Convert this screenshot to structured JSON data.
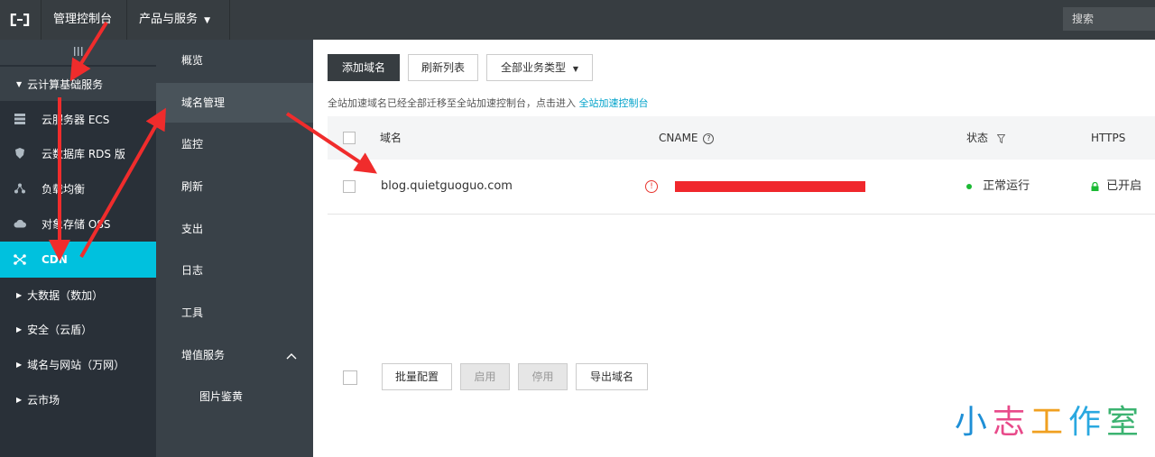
{
  "topbar": {
    "console_label": "管理控制台",
    "products_label": "产品与服务",
    "search_placeholder": "搜索"
  },
  "sidebar": {
    "section_label": "云计算基础服务",
    "items": [
      {
        "label": "云服务器 ECS",
        "icon": "server-icon"
      },
      {
        "label": "云数据库 RDS 版",
        "icon": "database-icon"
      },
      {
        "label": "负载均衡",
        "icon": "load-balancer-icon"
      },
      {
        "label": "对象存储 OSS",
        "icon": "cloud-storage-icon"
      },
      {
        "label": "CDN",
        "icon": "cdn-icon"
      }
    ],
    "groups": [
      {
        "label": "大数据（数加）"
      },
      {
        "label": "安全（云盾）"
      },
      {
        "label": "域名与网站（万网）"
      },
      {
        "label": "云市场"
      }
    ]
  },
  "subnav": {
    "items": [
      "概览",
      "域名管理",
      "监控",
      "刷新",
      "支出",
      "日志",
      "工具",
      "增值服务"
    ],
    "sub_item": "图片鉴黄"
  },
  "toolbar": {
    "add_domain": "添加域名",
    "refresh_list": "刷新列表",
    "all_types": "全部业务类型"
  },
  "notice": {
    "text": "全站加速域名已经全部迁移至全站加速控制台，点击进入",
    "link": "全站加速控制台"
  },
  "table": {
    "headers": {
      "domain": "域名",
      "cname": "CNAME",
      "status": "状态",
      "https": "HTTPS"
    },
    "rows": [
      {
        "domain": "blog.quietguoguo.com",
        "status": "正常运行",
        "https": "已开启"
      }
    ]
  },
  "bottom_actions": {
    "batch_config": "批量配置",
    "enable": "启用",
    "disable": "停用",
    "export": "导出域名"
  },
  "watermark": {
    "chars": [
      "小",
      "志",
      "工",
      "作",
      "室"
    ],
    "colors": [
      "#1e8fd6",
      "#e84a8a",
      "#f0a020",
      "#2aa8e0",
      "#3cb371"
    ]
  },
  "colors": {
    "topbar": "#373d41",
    "sidebar": "#293038",
    "subnav": "#394148",
    "accent": "#00c1de",
    "arrow": "#f02c2c"
  }
}
